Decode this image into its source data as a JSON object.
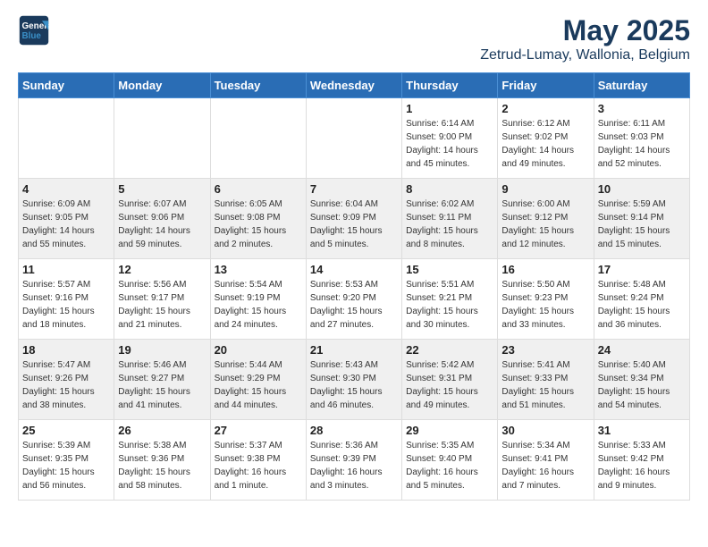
{
  "header": {
    "logo_line1": "General",
    "logo_line2": "Blue",
    "title": "May 2025",
    "subtitle": "Zetrud-Lumay, Wallonia, Belgium"
  },
  "days_of_week": [
    "Sunday",
    "Monday",
    "Tuesday",
    "Wednesday",
    "Thursday",
    "Friday",
    "Saturday"
  ],
  "weeks": [
    [
      {
        "day": "",
        "info": ""
      },
      {
        "day": "",
        "info": ""
      },
      {
        "day": "",
        "info": ""
      },
      {
        "day": "",
        "info": ""
      },
      {
        "day": "1",
        "info": "Sunrise: 6:14 AM\nSunset: 9:00 PM\nDaylight: 14 hours\nand 45 minutes."
      },
      {
        "day": "2",
        "info": "Sunrise: 6:12 AM\nSunset: 9:02 PM\nDaylight: 14 hours\nand 49 minutes."
      },
      {
        "day": "3",
        "info": "Sunrise: 6:11 AM\nSunset: 9:03 PM\nDaylight: 14 hours\nand 52 minutes."
      }
    ],
    [
      {
        "day": "4",
        "info": "Sunrise: 6:09 AM\nSunset: 9:05 PM\nDaylight: 14 hours\nand 55 minutes."
      },
      {
        "day": "5",
        "info": "Sunrise: 6:07 AM\nSunset: 9:06 PM\nDaylight: 14 hours\nand 59 minutes."
      },
      {
        "day": "6",
        "info": "Sunrise: 6:05 AM\nSunset: 9:08 PM\nDaylight: 15 hours\nand 2 minutes."
      },
      {
        "day": "7",
        "info": "Sunrise: 6:04 AM\nSunset: 9:09 PM\nDaylight: 15 hours\nand 5 minutes."
      },
      {
        "day": "8",
        "info": "Sunrise: 6:02 AM\nSunset: 9:11 PM\nDaylight: 15 hours\nand 8 minutes."
      },
      {
        "day": "9",
        "info": "Sunrise: 6:00 AM\nSunset: 9:12 PM\nDaylight: 15 hours\nand 12 minutes."
      },
      {
        "day": "10",
        "info": "Sunrise: 5:59 AM\nSunset: 9:14 PM\nDaylight: 15 hours\nand 15 minutes."
      }
    ],
    [
      {
        "day": "11",
        "info": "Sunrise: 5:57 AM\nSunset: 9:16 PM\nDaylight: 15 hours\nand 18 minutes."
      },
      {
        "day": "12",
        "info": "Sunrise: 5:56 AM\nSunset: 9:17 PM\nDaylight: 15 hours\nand 21 minutes."
      },
      {
        "day": "13",
        "info": "Sunrise: 5:54 AM\nSunset: 9:19 PM\nDaylight: 15 hours\nand 24 minutes."
      },
      {
        "day": "14",
        "info": "Sunrise: 5:53 AM\nSunset: 9:20 PM\nDaylight: 15 hours\nand 27 minutes."
      },
      {
        "day": "15",
        "info": "Sunrise: 5:51 AM\nSunset: 9:21 PM\nDaylight: 15 hours\nand 30 minutes."
      },
      {
        "day": "16",
        "info": "Sunrise: 5:50 AM\nSunset: 9:23 PM\nDaylight: 15 hours\nand 33 minutes."
      },
      {
        "day": "17",
        "info": "Sunrise: 5:48 AM\nSunset: 9:24 PM\nDaylight: 15 hours\nand 36 minutes."
      }
    ],
    [
      {
        "day": "18",
        "info": "Sunrise: 5:47 AM\nSunset: 9:26 PM\nDaylight: 15 hours\nand 38 minutes."
      },
      {
        "day": "19",
        "info": "Sunrise: 5:46 AM\nSunset: 9:27 PM\nDaylight: 15 hours\nand 41 minutes."
      },
      {
        "day": "20",
        "info": "Sunrise: 5:44 AM\nSunset: 9:29 PM\nDaylight: 15 hours\nand 44 minutes."
      },
      {
        "day": "21",
        "info": "Sunrise: 5:43 AM\nSunset: 9:30 PM\nDaylight: 15 hours\nand 46 minutes."
      },
      {
        "day": "22",
        "info": "Sunrise: 5:42 AM\nSunset: 9:31 PM\nDaylight: 15 hours\nand 49 minutes."
      },
      {
        "day": "23",
        "info": "Sunrise: 5:41 AM\nSunset: 9:33 PM\nDaylight: 15 hours\nand 51 minutes."
      },
      {
        "day": "24",
        "info": "Sunrise: 5:40 AM\nSunset: 9:34 PM\nDaylight: 15 hours\nand 54 minutes."
      }
    ],
    [
      {
        "day": "25",
        "info": "Sunrise: 5:39 AM\nSunset: 9:35 PM\nDaylight: 15 hours\nand 56 minutes."
      },
      {
        "day": "26",
        "info": "Sunrise: 5:38 AM\nSunset: 9:36 PM\nDaylight: 15 hours\nand 58 minutes."
      },
      {
        "day": "27",
        "info": "Sunrise: 5:37 AM\nSunset: 9:38 PM\nDaylight: 16 hours\nand 1 minute."
      },
      {
        "day": "28",
        "info": "Sunrise: 5:36 AM\nSunset: 9:39 PM\nDaylight: 16 hours\nand 3 minutes."
      },
      {
        "day": "29",
        "info": "Sunrise: 5:35 AM\nSunset: 9:40 PM\nDaylight: 16 hours\nand 5 minutes."
      },
      {
        "day": "30",
        "info": "Sunrise: 5:34 AM\nSunset: 9:41 PM\nDaylight: 16 hours\nand 7 minutes."
      },
      {
        "day": "31",
        "info": "Sunrise: 5:33 AM\nSunset: 9:42 PM\nDaylight: 16 hours\nand 9 minutes."
      }
    ]
  ]
}
